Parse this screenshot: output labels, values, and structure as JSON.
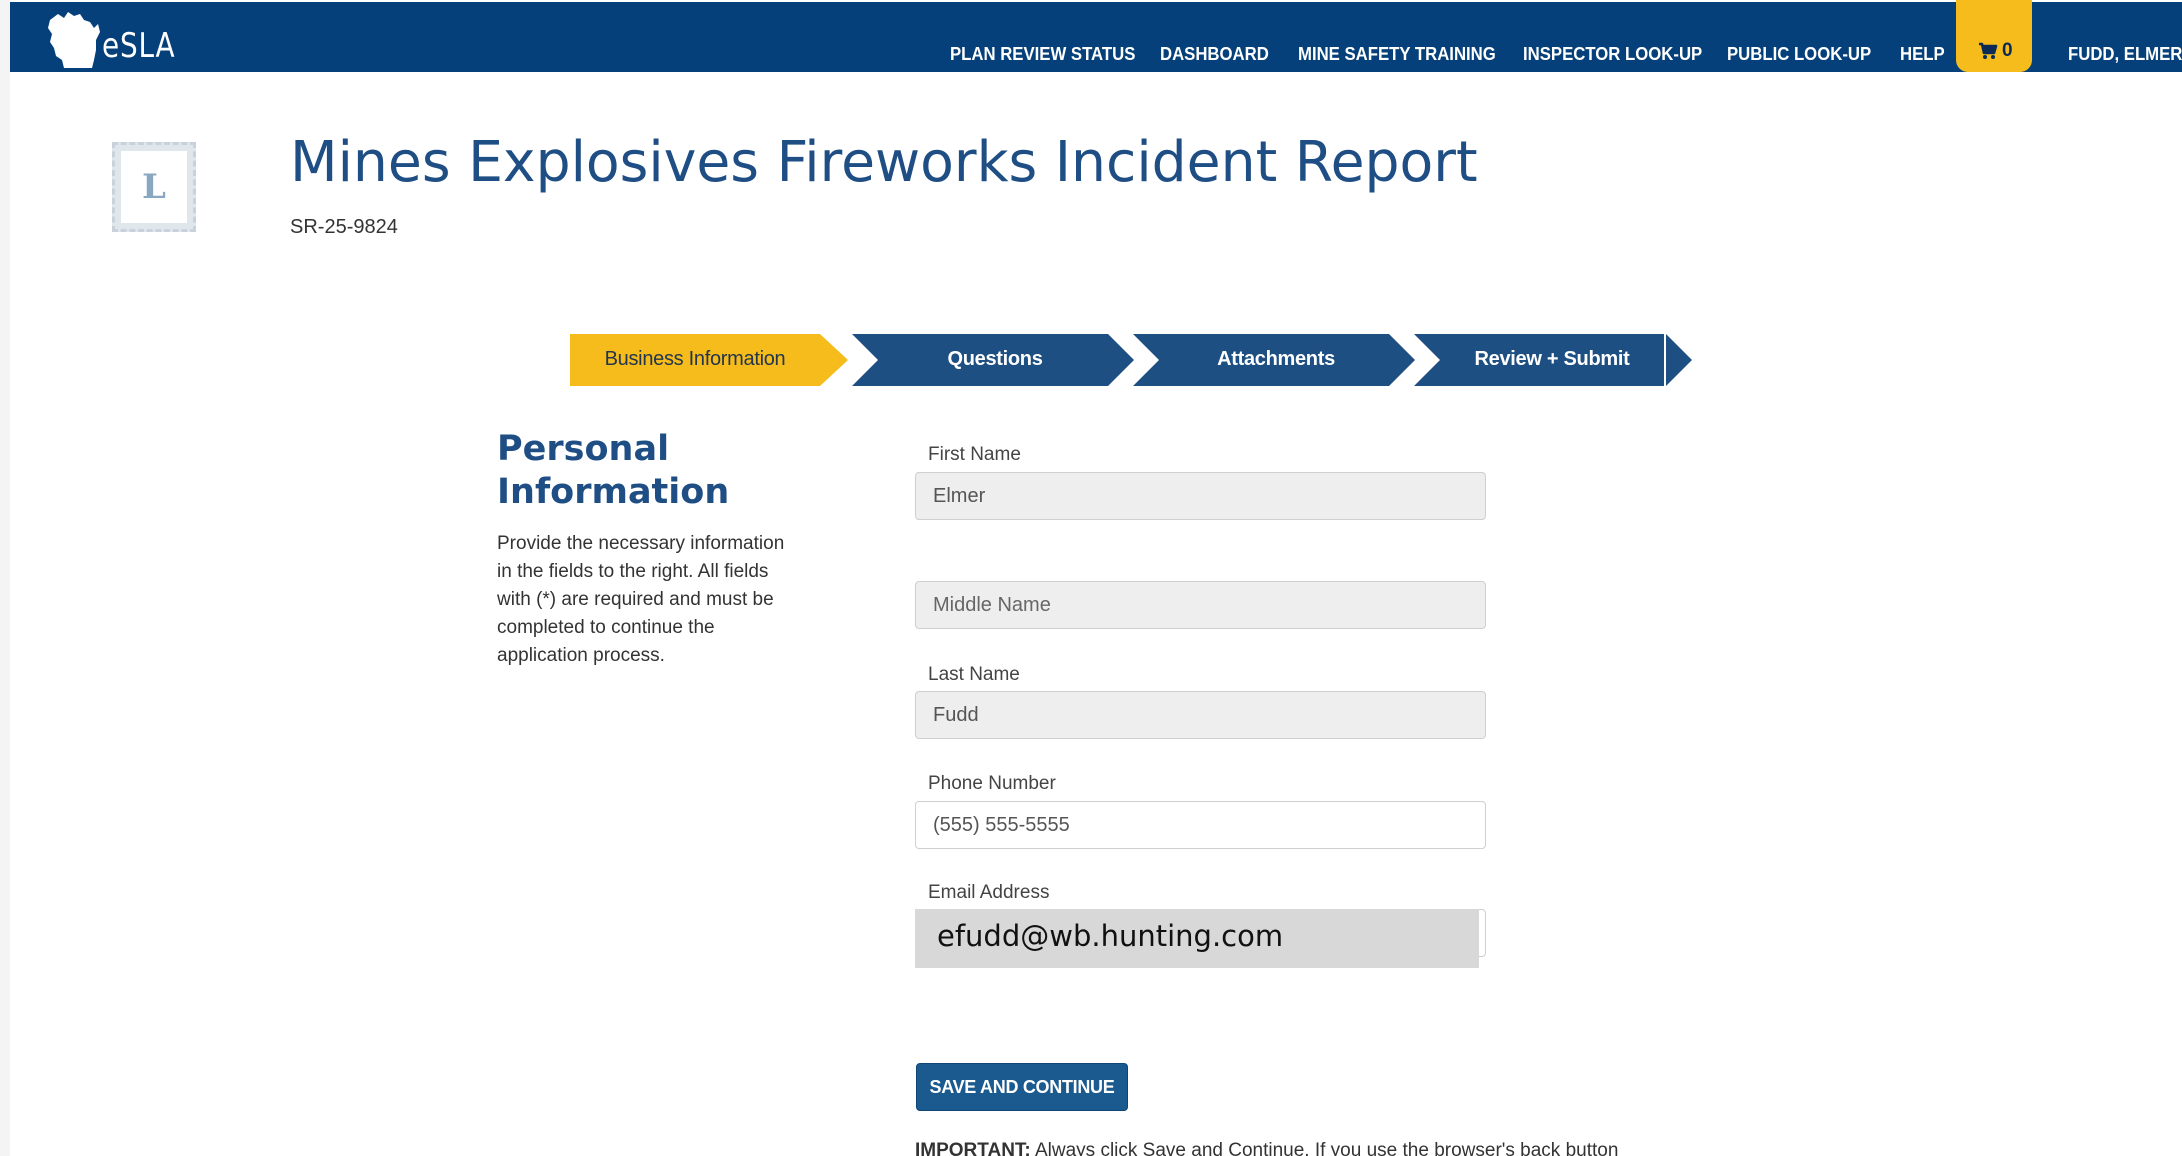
{
  "app": {
    "logo_text": "eSLA",
    "logo_icon": "wisconsin-map-icon"
  },
  "nav": {
    "items": [
      "PLAN REVIEW STATUS",
      "DASHBOARD",
      "MINE SAFETY TRAINING",
      "INSPECTOR LOOK-UP",
      "PUBLIC LOOK-UP",
      "HELP"
    ],
    "cart_count": "0",
    "cart_icon": "cart-icon",
    "user": "FUDD, ELMER"
  },
  "page": {
    "title": "Mines Explosives Fireworks Incident Report",
    "record_id": "SR-25-9824",
    "stamp_letter": "L"
  },
  "steps": [
    {
      "label": "Business Information",
      "state": "active"
    },
    {
      "label": "Questions",
      "state": "pending"
    },
    {
      "label": "Attachments",
      "state": "pending"
    },
    {
      "label": "Review + Submit",
      "state": "pending"
    }
  ],
  "section": {
    "title": "Personal Information",
    "description": "Provide the necessary information in the fields to the right. All fields with (*) are required and must be completed to continue the application process."
  },
  "form": {
    "first_name": {
      "label": "First Name",
      "value": "Elmer"
    },
    "middle_name": {
      "label": "",
      "value": "",
      "placeholder": "Middle Name"
    },
    "last_name": {
      "label": "Last Name",
      "value": "Fudd"
    },
    "phone": {
      "label": "Phone Number",
      "value": "(555) 555-5555"
    },
    "email": {
      "label": "Email Address",
      "value": "efudd@wb.hunting.com"
    }
  },
  "actions": {
    "save_label": "SAVE AND CONTINUE"
  },
  "notice": {
    "bold": "IMPORTANT:",
    "text": " Always click Save and Continue. If you use the browser's back button"
  },
  "colors": {
    "nav_bg": "#06407a",
    "accent_yellow": "#f6bc1c",
    "step_blue": "#1e4f82",
    "title_blue": "#1f4e85",
    "button_blue": "#1a5a8f"
  }
}
